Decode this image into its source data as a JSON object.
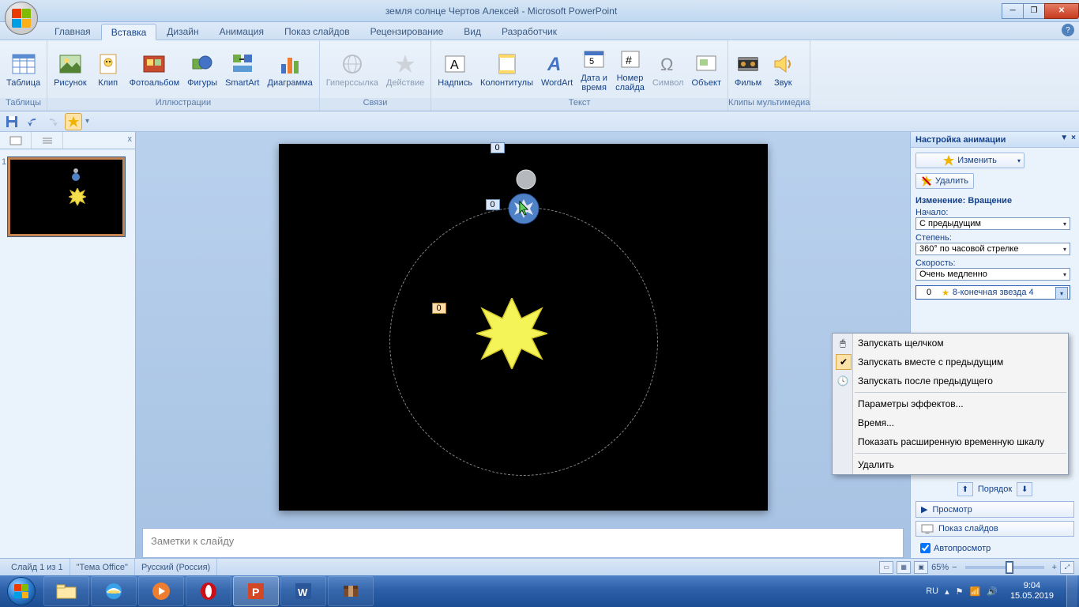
{
  "window": {
    "title": "земля солнце Чертов Алексей - Microsoft PowerPoint"
  },
  "tabs": {
    "home": "Главная",
    "insert": "Вставка",
    "design": "Дизайн",
    "animation": "Анимация",
    "slideshow": "Показ слайдов",
    "review": "Рецензирование",
    "view": "Вид",
    "developer": "Разработчик",
    "active": "Вставка"
  },
  "ribbon": {
    "tables": {
      "label": "Таблицы",
      "table": "Таблица"
    },
    "illustrations": {
      "label": "Иллюстрации",
      "picture": "Рисунок",
      "clip": "Клип",
      "photoalbum": "Фотоальбом",
      "shapes": "Фигуры",
      "smartart": "SmartArt",
      "chart": "Диаграмма"
    },
    "links": {
      "label": "Связи",
      "hyperlink": "Гиперссылка",
      "action": "Действие"
    },
    "text": {
      "label": "Текст",
      "textbox": "Надпись",
      "headerfooter": "Колонтитулы",
      "wordart": "WordArt",
      "datetime": "Дата и\nвремя",
      "slidenumber": "Номер\nслайда",
      "symbol": "Символ",
      "object": "Объект"
    },
    "media": {
      "label": "Клипы мультимедиа",
      "movie": "Фильм",
      "sound": "Звук"
    }
  },
  "slidesPanel": {
    "slideNumber": "1"
  },
  "slide": {
    "tag1": "0",
    "tag2": "0",
    "sunTag": "0"
  },
  "notes": {
    "placeholder": "Заметки к слайду"
  },
  "animPane": {
    "title": "Настройка анимации",
    "modify": "Изменить",
    "remove": "Удалить",
    "changeSpin": "Изменение: Вращение",
    "startLabel": "Начало:",
    "startValue": "С предыдущим",
    "amountLabel": "Степень:",
    "amountValue": "360° по часовой стрелке",
    "speedLabel": "Скорость:",
    "speedValue": "Очень медленно",
    "effectIndex": "0",
    "effectName": "8-конечная звезда 4",
    "orderLabel": "Порядок",
    "play": "Просмотр",
    "slideshow": "Показ слайдов",
    "autoPreview": "Автопросмотр"
  },
  "contextMenu": {
    "startOnClick": "Запускать щелчком",
    "startWithPrev": "Запускать вместе с предыдущим",
    "startAfterPrev": "Запускать после предыдущего",
    "effectOptions": "Параметры эффектов...",
    "timing": "Время...",
    "showTimeline": "Показать расширенную временную шкалу",
    "remove": "Удалить"
  },
  "status": {
    "slideInfo": "Слайд 1 из 1",
    "theme": "\"Тема Office\"",
    "language": "Русский (Россия)",
    "zoom": "65%"
  },
  "tray": {
    "lang": "RU",
    "time": "9:04",
    "date": "15.05.2019"
  }
}
